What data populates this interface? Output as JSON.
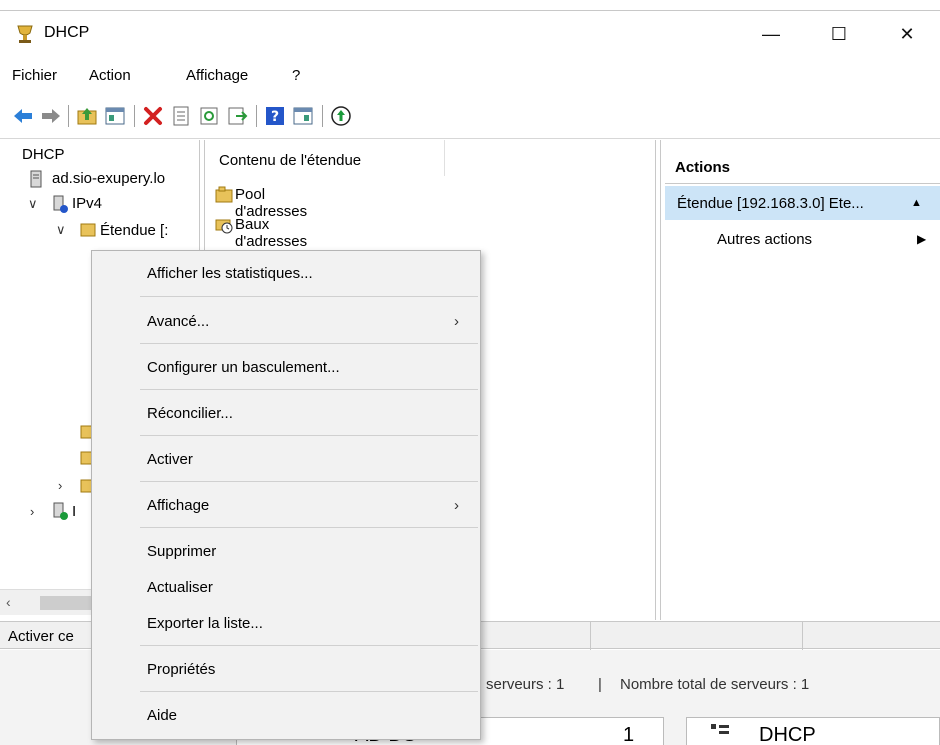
{
  "window": {
    "title": "DHCP"
  },
  "titlebar": {
    "minimize": "—",
    "maximize": "☐",
    "close": "✕"
  },
  "menu": {
    "items": [
      "Fichier",
      "Action",
      "Affichage",
      "?"
    ]
  },
  "tree": {
    "root": "DHCP",
    "server": "ad.sio-exupery.lo",
    "ipv4": "IPv4",
    "scope": "Étendue [:",
    "ipv6_partial": "I"
  },
  "content": {
    "header": "Contenu de l'étendue",
    "rows": [
      "Pool d'adresses",
      "Baux d'adresses"
    ]
  },
  "actions": {
    "header": "Actions",
    "scope_item": "Étendue [192.168.3.0] Ete...",
    "more": "Autres actions"
  },
  "status": {
    "text": "Activer ce"
  },
  "dashboard": {
    "servers_text": "serveurs : 1",
    "pipe": "|",
    "total_text": "Nombre total de serveurs : 1",
    "tile1_label": "AD DS",
    "tile1_count": "1",
    "tile2_label": "DHCP"
  },
  "context_menu": {
    "items": [
      {
        "label": "Afficher les statistiques...",
        "submenu": ""
      },
      {
        "label": "Avancé...",
        "submenu": "›"
      },
      {
        "label": "Configurer un basculement...",
        "submenu": ""
      },
      {
        "label": "Réconcilier...",
        "submenu": ""
      },
      {
        "label": "Activer",
        "submenu": ""
      },
      {
        "label": "Affichage",
        "submenu": "›"
      },
      {
        "label": "Supprimer",
        "submenu": ""
      },
      {
        "label": "Actualiser",
        "submenu": ""
      },
      {
        "label": "Exporter la liste...",
        "submenu": ""
      },
      {
        "label": "Propriétés",
        "submenu": ""
      },
      {
        "label": "Aide",
        "submenu": ""
      }
    ]
  },
  "colors": {
    "selection": "#cce4f7",
    "folder": "#e8c25a",
    "delete_red": "#d32020",
    "back_arrow": "#2b7fd8",
    "help_blue": "#2456c9"
  }
}
